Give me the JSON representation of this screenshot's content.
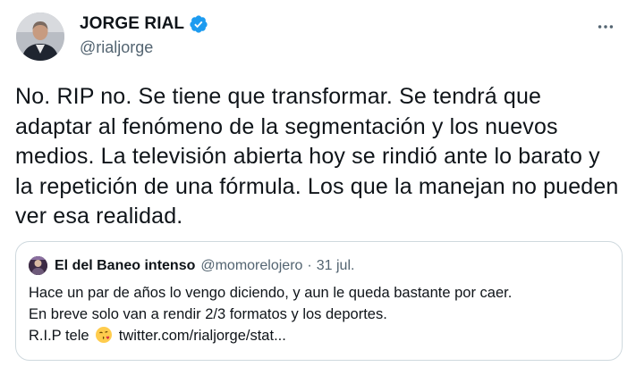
{
  "author": {
    "display_name": "JORGE RIAL",
    "handle": "@rialjorge",
    "verified": true,
    "verified_color": "#1d9bf0"
  },
  "tweet": {
    "text": "No. RIP no. Se tiene que transformar. Se tendrá que adaptar al fenómeno de la segmentación y los nuevos medios. La televisión abierta hoy se rindió ante lo barato y la repetición de una fórmula. Los que la manejan no pueden ver esa realidad."
  },
  "quoted_tweet": {
    "display_name": "El del Baneo intenso",
    "handle": "@momorelojero",
    "separator": "·",
    "date": "31 jul.",
    "lines": [
      "Hace un par de años lo vengo diciendo, y aun le queda bastante por caer.",
      "En breve solo van a rendir 2/3 formatos y los deportes."
    ],
    "last_line_prefix": "R.I.P tele",
    "last_line_emoji": "face-blowing-kiss-emoji",
    "last_line_link": "twitter.com/rialjorge/stat..."
  },
  "icons": {
    "more": "more-horizontal-icon",
    "verified": "verified-badge-icon"
  },
  "colors": {
    "text_primary": "#0f1419",
    "text_secondary": "#536471",
    "border": "#cfd9de"
  }
}
